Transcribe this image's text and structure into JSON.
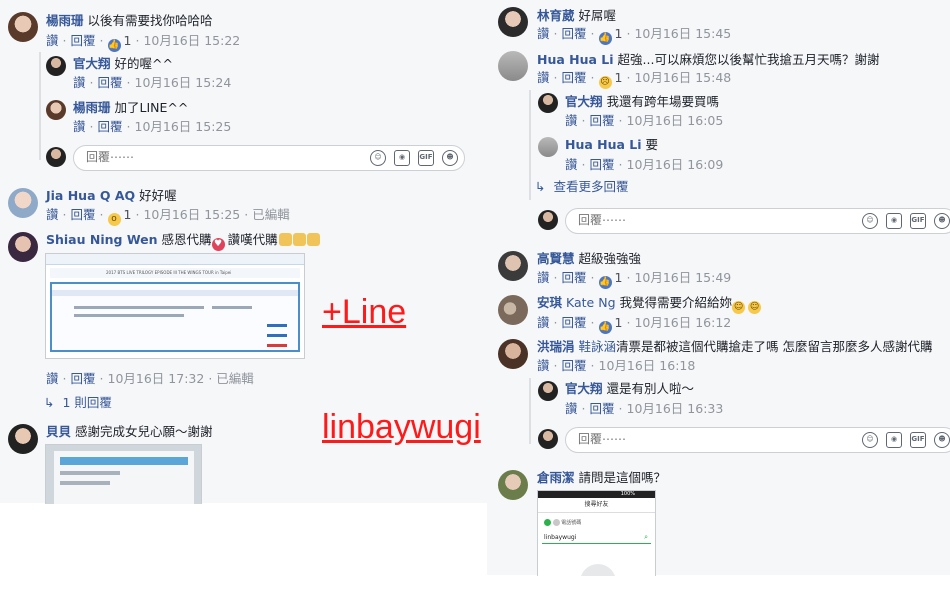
{
  "actions": {
    "like": "讚",
    "reply": "回覆",
    "sep": "·"
  },
  "left": {
    "c1": {
      "name": "楊雨珊",
      "text": "以後有需要找你哈哈哈",
      "likes": "1",
      "time": "10月16日 15:22"
    },
    "c1r1": {
      "name": "官大翔",
      "text": "好的喔^^",
      "time": "10月16日 15:24"
    },
    "c1r2": {
      "name": "楊雨珊",
      "text": "加了LINE^^",
      "time": "10月16日 15:25"
    },
    "reply_placeholder": "回覆⋯⋯",
    "c2": {
      "name": "Jia Hua Q AQ",
      "text": "好好喔",
      "likes": "1",
      "time": "10月16日 15:25",
      "edited": "已編輯"
    },
    "c3": {
      "name": "Shiau Ning Wen",
      "text": "感恩代購",
      "text2": "讚嘆代購",
      "time": "10月16日 17:32",
      "edited": "已編輯",
      "replies": "1 則回覆",
      "ticket_title": "2017 BTS LIVE TRILOGY EPISODE III THE WINGS TOUR in Taipei"
    },
    "c4": {
      "name": "貝貝",
      "text": "感謝完成女兒心願～謝謝"
    }
  },
  "right": {
    "c1": {
      "name": "林育葳",
      "text": "好屌喔",
      "likes": "1",
      "time": "10月16日 15:45"
    },
    "c2": {
      "name": "Hua Hua Li",
      "text": "超強...可以麻煩您以後幫忙我搶五月天嗎？謝謝",
      "likes": "1",
      "time": "10月16日 15:48"
    },
    "c2r1": {
      "name": "官大翔",
      "text": "我還有跨年場要買嗎",
      "time": "10月16日 16:05"
    },
    "c2r2": {
      "name": "Hua Hua Li",
      "text": "要",
      "time": "10月16日 16:09"
    },
    "more": "查看更多回覆",
    "reply_placeholder": "回覆⋯⋯",
    "c3": {
      "name": "高賢慧",
      "text": "超級強強強",
      "likes": "1",
      "time": "10月16日 15:49"
    },
    "c4": {
      "name": "安琪",
      "tag": "Kate Ng",
      "text": "我覺得需要介紹給妳",
      "likes": "1",
      "time": "10月16日 16:12"
    },
    "c5": {
      "name": "洪瑞涓",
      "tag": "鞋詠涵",
      "text": "清票是都被這個代購搶走了嗎 怎麼留言那麼多人感謝代購",
      "time": "10月16日 16:18"
    },
    "c5r1": {
      "name": "官大翔",
      "text": "還是有別人啦～",
      "time": "10月16日 16:33"
    },
    "c6": {
      "name": "倉雨潔",
      "text": "請問是這個嗎？"
    },
    "phone": {
      "header": "搜尋好友",
      "tab": "電話號碼",
      "search": "linbaywugi",
      "status": "100%"
    }
  },
  "overlay": {
    "line": "+Line",
    "id": "linbaywugi"
  },
  "colors": {
    "link": "#365899",
    "overlay": "#ff1a1a",
    "bg": "#f6f7f9"
  }
}
